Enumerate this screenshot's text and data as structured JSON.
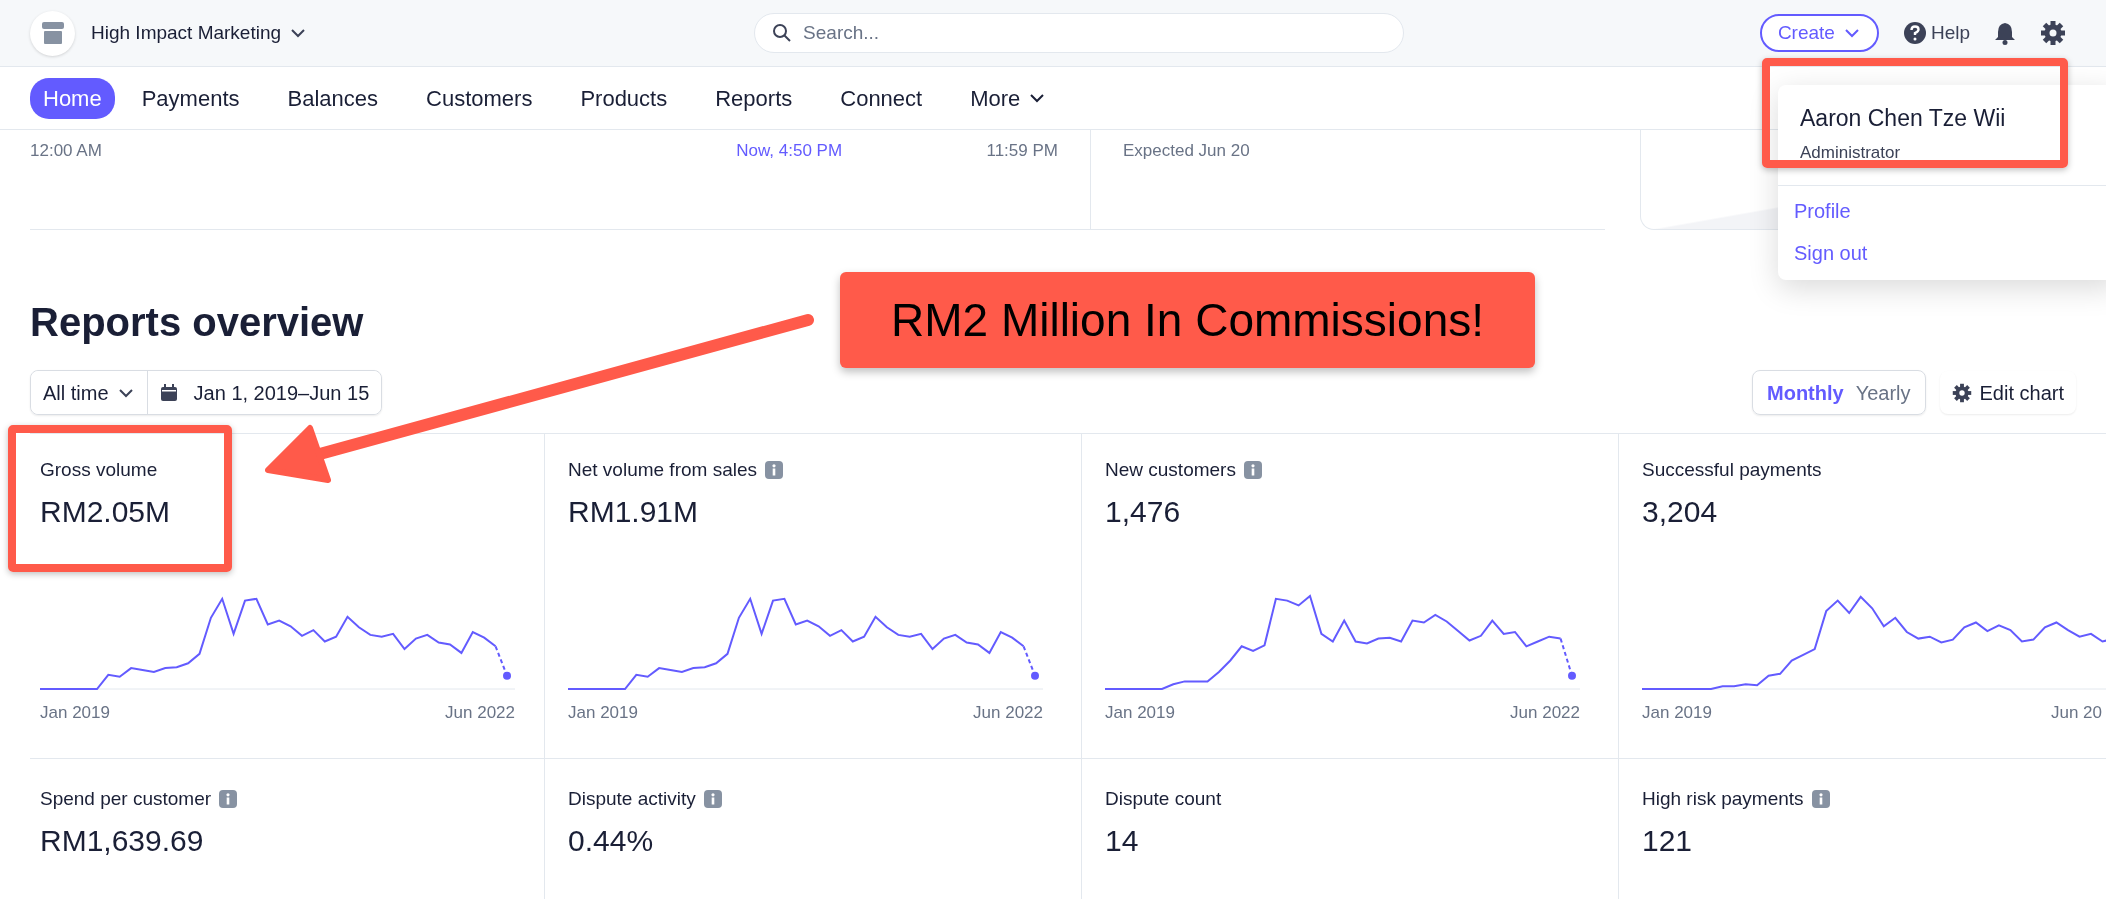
{
  "header": {
    "account": "High Impact Marketing",
    "search": {
      "placeholder": "Search..."
    },
    "create": "Create",
    "help": "Help"
  },
  "nav": [
    {
      "label": "Home",
      "selected": true
    },
    {
      "label": "Payments",
      "selected": false
    },
    {
      "label": "Balances",
      "selected": false
    },
    {
      "label": "Customers",
      "selected": false
    },
    {
      "label": "Products",
      "selected": false
    },
    {
      "label": "Reports",
      "selected": false
    },
    {
      "label": "Connect",
      "selected": false
    },
    {
      "label": "More",
      "selected": false,
      "dropdown": true
    }
  ],
  "timeline": {
    "start": "12:00 AM",
    "now": "Now, 4:50 PM",
    "end": "11:59 PM",
    "expected": "Expected Jun 20"
  },
  "user_menu": {
    "name": "Aaron Chen Tze Wii",
    "role": "Administrator",
    "items": [
      "Profile",
      "Sign out"
    ]
  },
  "reports": {
    "title": "Reports overview",
    "range": "All time",
    "dates": "Jan 1, 2019–Jun 15",
    "interval": [
      {
        "label": "Monthly",
        "selected": true
      },
      {
        "label": "Yearly",
        "selected": false
      }
    ],
    "edit": "Edit chart",
    "metric_rows": [
      {
        "metrics": [
          {
            "title": "Gross volume",
            "info": false,
            "value": "RM2.05M",
            "start_label": "Jan 2019",
            "end_label": "Jun 2022"
          },
          {
            "title": "Net volume from sales",
            "info": true,
            "value": "RM1.91M",
            "start_label": "Jan 2019",
            "end_label": "Jun 2022"
          },
          {
            "title": "New customers",
            "info": true,
            "value": "1,476",
            "start_label": "Jan 2019",
            "end_label": "Jun 2022"
          },
          {
            "title": "Successful payments",
            "info": false,
            "value": "3,204",
            "start_label": "Jan 2019",
            "end_label": "Jun 20"
          }
        ]
      },
      {
        "metrics": [
          {
            "title": "Spend per customer",
            "info": true,
            "value": "RM1,639.69"
          },
          {
            "title": "Dispute activity",
            "info": true,
            "value": "0.44%"
          },
          {
            "title": "Dispute count",
            "info": false,
            "value": "14"
          },
          {
            "title": "High risk payments",
            "info": true,
            "value": "121"
          }
        ]
      }
    ]
  },
  "annotation": {
    "callout": "RM2 Million In Commissions!"
  }
}
